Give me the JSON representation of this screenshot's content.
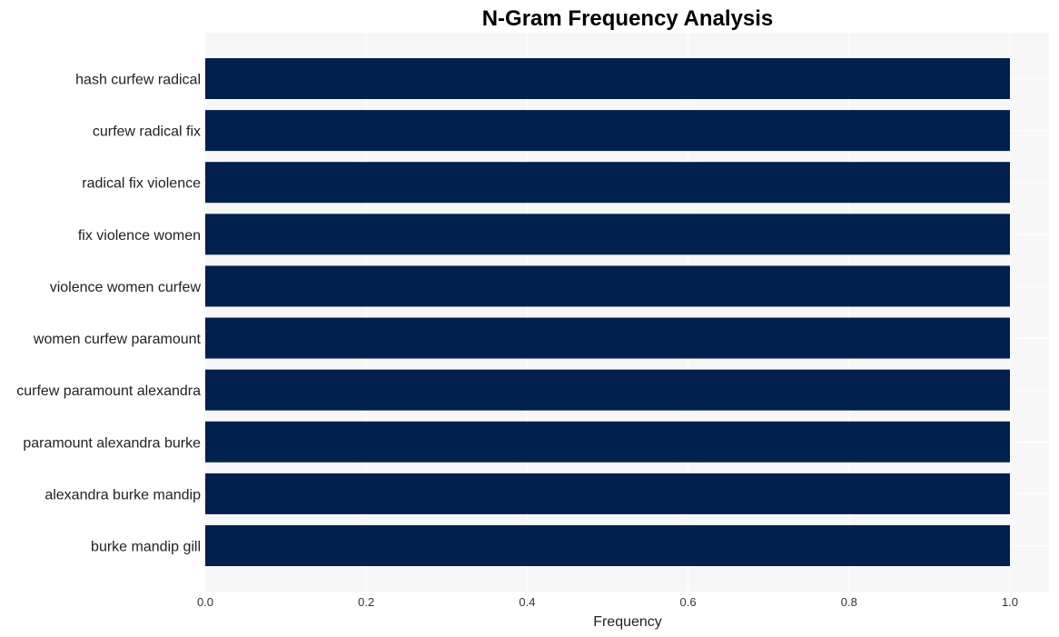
{
  "chart_data": {
    "type": "bar",
    "orientation": "horizontal",
    "title": "N-Gram Frequency Analysis",
    "xlabel": "Frequency",
    "ylabel": "",
    "categories": [
      "hash curfew radical",
      "curfew radical fix",
      "radical fix violence",
      "fix violence women",
      "violence women curfew",
      "women curfew paramount",
      "curfew paramount alexandra",
      "paramount alexandra burke",
      "alexandra burke mandip",
      "burke mandip gill"
    ],
    "values": [
      1,
      1,
      1,
      1,
      1,
      1,
      1,
      1,
      1,
      1
    ],
    "xlim": [
      0,
      1.05
    ],
    "xticks": [
      0.0,
      0.2,
      0.4,
      0.6,
      0.8,
      1.0
    ],
    "xtick_labels": [
      "0.0",
      "0.2",
      "0.4",
      "0.6",
      "0.8",
      "1.0"
    ],
    "grid": true,
    "legend": "none",
    "colors": {
      "bar": "#00214d",
      "plot_background": "#f7f7f7",
      "grid": "#ffffff"
    }
  }
}
